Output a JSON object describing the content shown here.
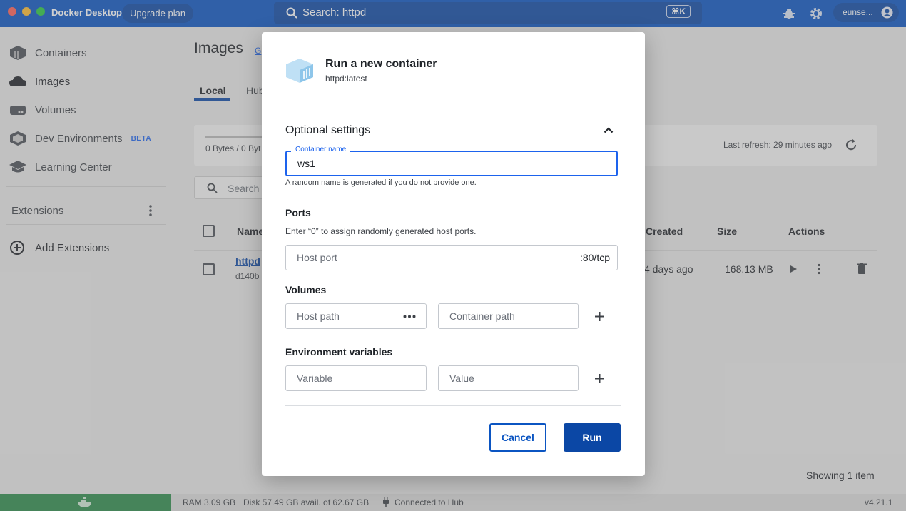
{
  "window": {
    "app_title": "Docker Desktop",
    "upgrade_label": "Upgrade plan",
    "search_text": "Search: httpd",
    "search_shortcut": "⌘K",
    "user_label": "eunse..."
  },
  "sidebar": {
    "items": [
      {
        "label": "Containers",
        "icon": "containers-icon"
      },
      {
        "label": "Images",
        "icon": "images-icon"
      },
      {
        "label": "Volumes",
        "icon": "volumes-icon"
      },
      {
        "label": "Dev Environments",
        "icon": "dev-environments-icon",
        "badge": "BETA"
      },
      {
        "label": "Learning Center",
        "icon": "learning-center-icon"
      }
    ],
    "extensions_label": "Extensions",
    "add_extensions_label": "Add Extensions"
  },
  "main": {
    "page_title": "Images",
    "page_title_link": "G",
    "tabs": [
      {
        "label": "Local",
        "active": true
      },
      {
        "label": "Hub",
        "active": false
      }
    ],
    "storage_text": "0 Bytes / 0 Byt",
    "last_refresh": "Last refresh: 29 minutes ago",
    "search_placeholder": "Search",
    "table": {
      "headers": [
        "Name",
        "Created",
        "Size",
        "Actions"
      ],
      "rows": [
        {
          "name": "httpd",
          "id": "d140b",
          "created": "4 days ago",
          "size": "168.13 MB"
        }
      ]
    },
    "showing": "Showing 1 item"
  },
  "status_bar": {
    "ram": "RAM 3.09 GB",
    "disk": "Disk 57.49 GB avail. of 62.67 GB",
    "hub": "Connected to Hub",
    "version": "v4.21.1"
  },
  "modal": {
    "title": "Run a new container",
    "subtitle": "httpd:latest",
    "optional_settings": "Optional settings",
    "container_name_label": "Container name",
    "container_name_value": "ws1",
    "container_name_help": "A random name is generated if you do not provide one.",
    "ports_title": "Ports",
    "ports_help": "Enter “0” to assign randomly generated host ports.",
    "host_port_placeholder": "Host port",
    "port_suffix": ":80/tcp",
    "volumes_title": "Volumes",
    "host_path_placeholder": "Host path",
    "container_path_placeholder": "Container path",
    "env_title": "Environment variables",
    "variable_placeholder": "Variable",
    "value_placeholder": "Value",
    "cancel_label": "Cancel",
    "run_label": "Run"
  },
  "colors": {
    "brand_blue": "#0b47a5",
    "titlebar": "#0a54c2",
    "focus_blue": "#1d63ed",
    "status_green": "#2b8a4a"
  }
}
